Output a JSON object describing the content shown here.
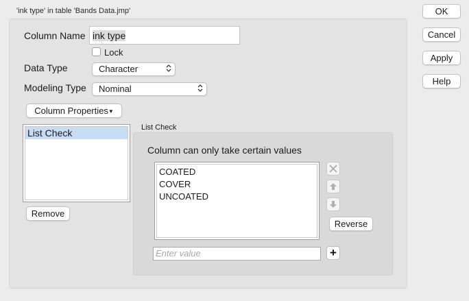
{
  "dialog_title": "'ink type' in table 'Bands Data.jmp'",
  "column_name": {
    "label": "Column Name",
    "value": "ink type"
  },
  "lock": {
    "label": "Lock",
    "checked": false
  },
  "data_type": {
    "label": "Data Type",
    "value": "Character"
  },
  "modeling_type": {
    "label": "Modeling Type",
    "value": "Nominal"
  },
  "column_properties": {
    "label": "Column Properties"
  },
  "properties_list": {
    "items": [
      "List Check"
    ],
    "selected": "List Check"
  },
  "remove_label": "Remove",
  "list_check": {
    "group_label": "List Check",
    "description": "Column can only take certain values",
    "values": [
      "COATED",
      "COVER",
      "UNCOATED"
    ],
    "reverse_label": "Reverse",
    "enter_placeholder": "Enter value"
  },
  "buttons": {
    "ok": "OK",
    "cancel": "Cancel",
    "apply": "Apply",
    "help": "Help"
  }
}
